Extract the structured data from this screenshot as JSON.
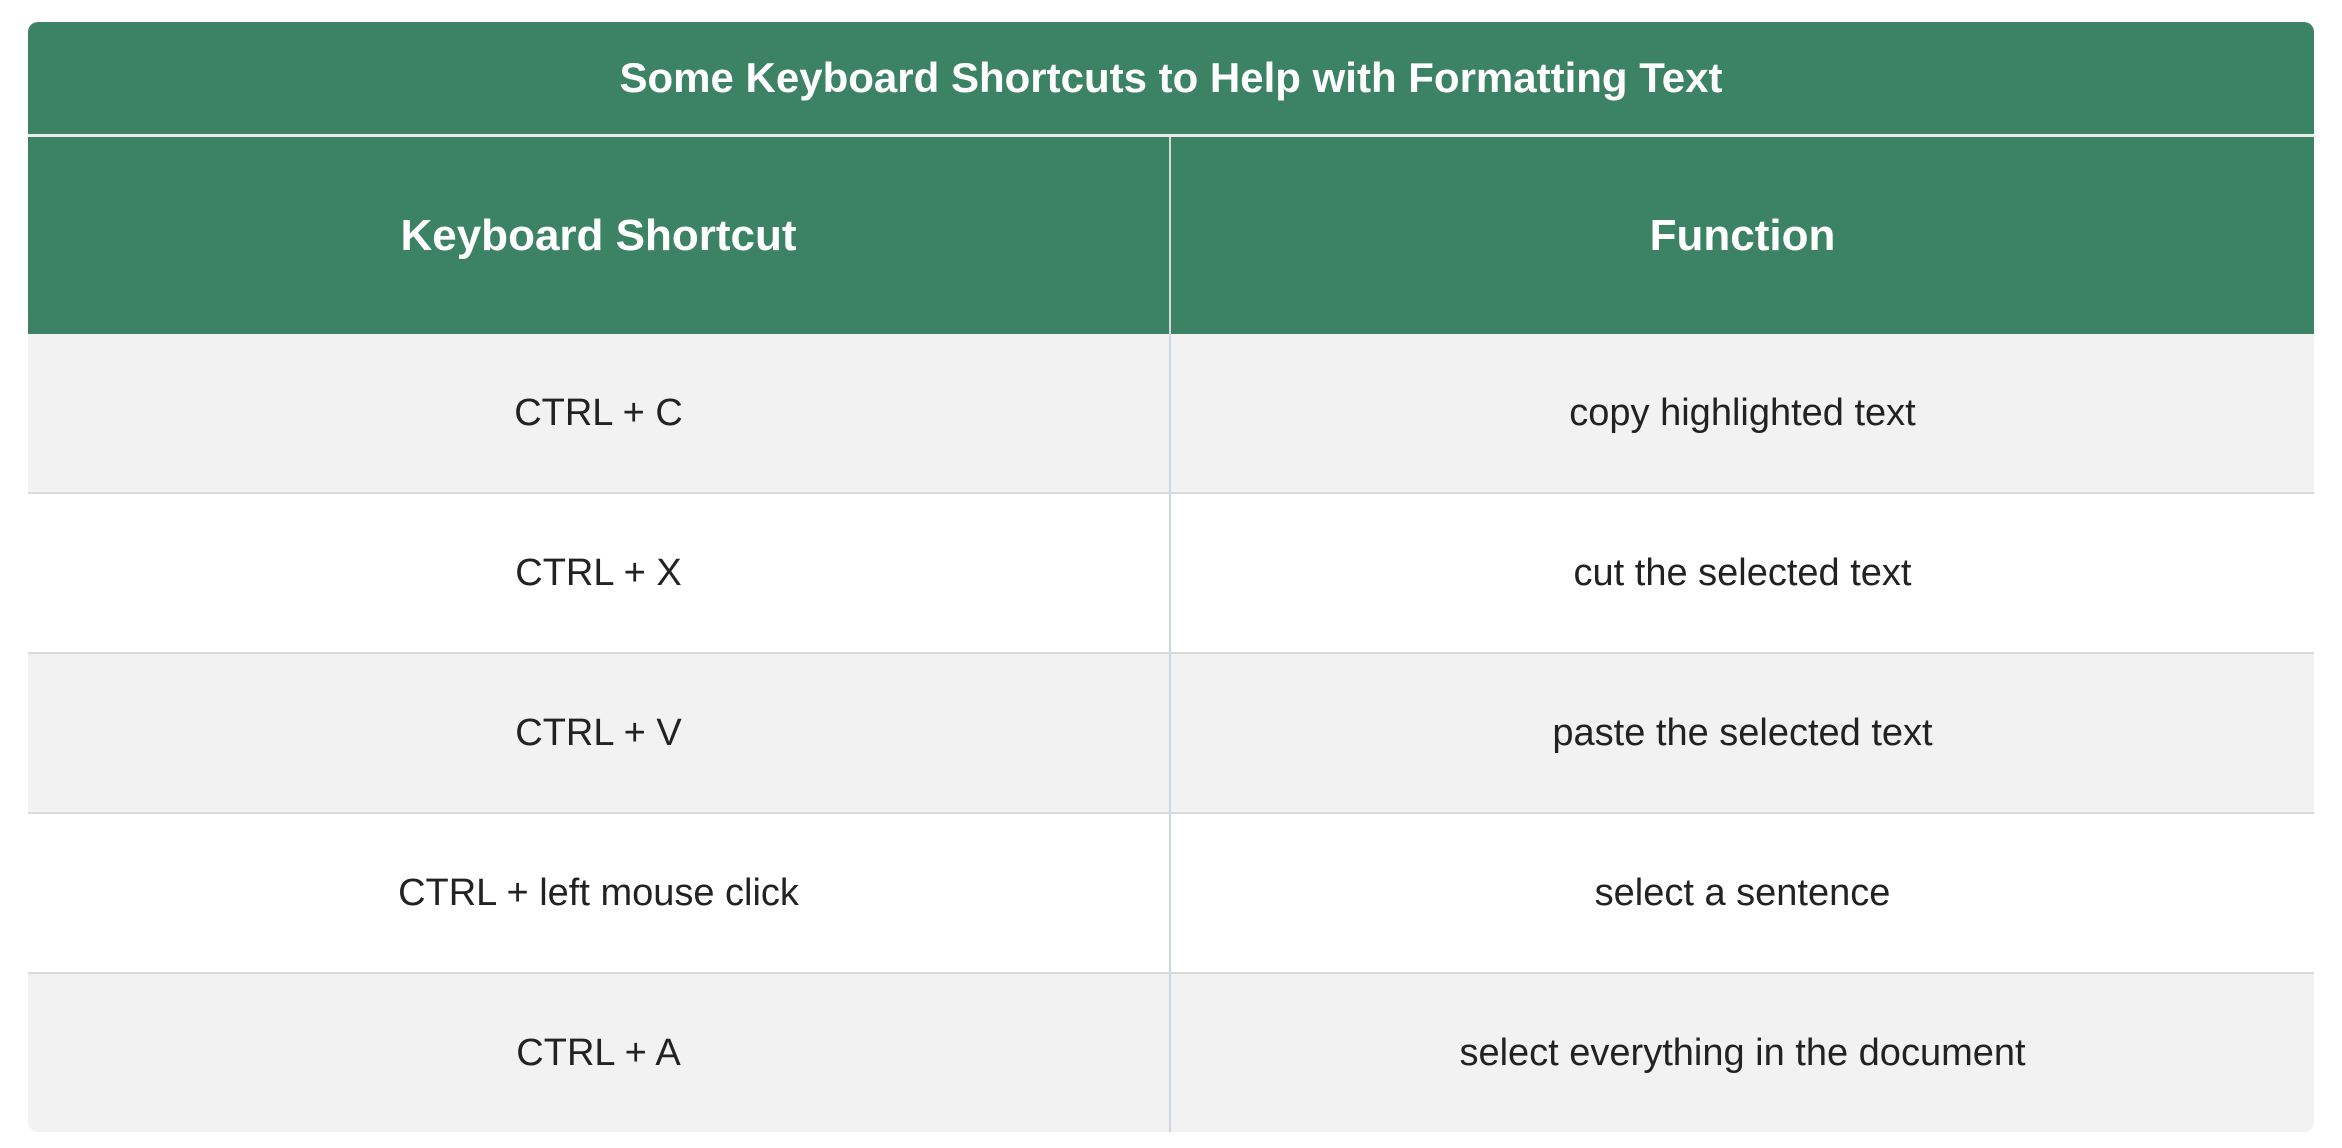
{
  "table": {
    "title": "Some Keyboard Shortcuts to Help with Formatting Text",
    "headers": [
      "Keyboard Shortcut",
      "Function"
    ],
    "rows": [
      [
        "CTRL + C",
        "copy highlighted text"
      ],
      [
        "CTRL + X",
        "cut the selected text"
      ],
      [
        "CTRL + V",
        "paste the selected text"
      ],
      [
        "CTRL + left mouse click",
        "select a sentence"
      ],
      [
        "CTRL + A",
        "select everything in the document"
      ]
    ]
  },
  "colors": {
    "header_background": "#3b8364",
    "header_text": "#ffffff",
    "striped_row": "#f2f2f2",
    "plain_row": "#ffffff"
  }
}
